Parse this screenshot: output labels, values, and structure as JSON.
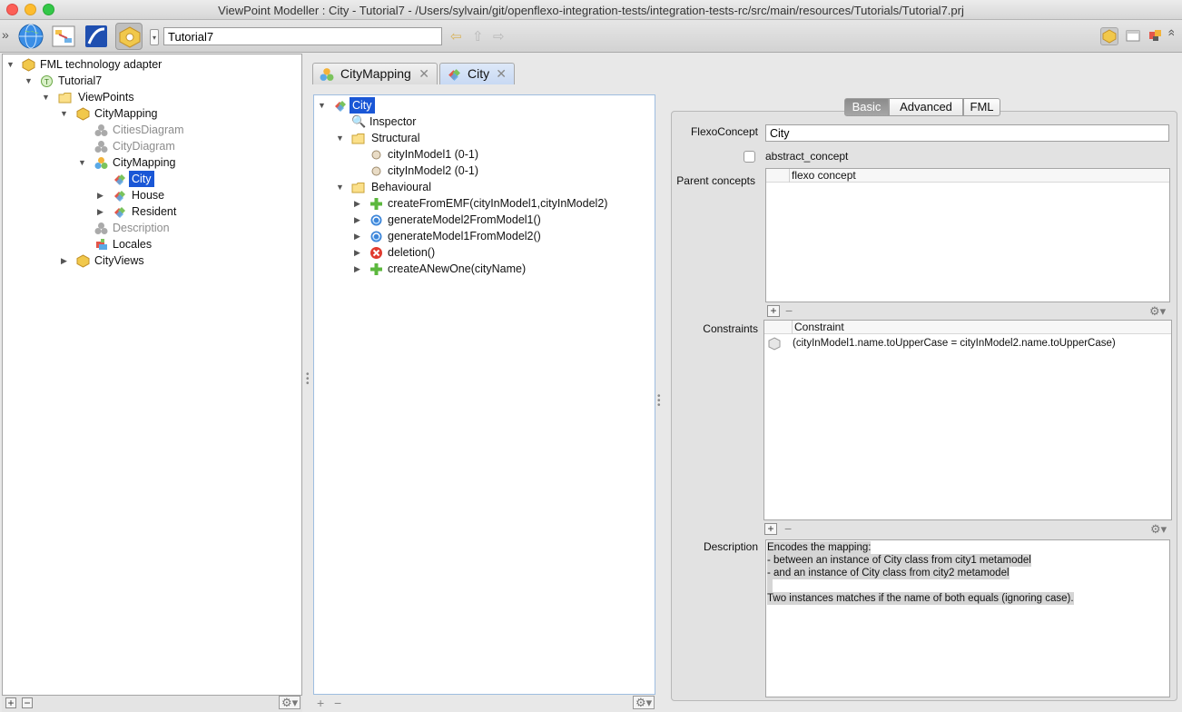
{
  "window": {
    "title": "ViewPoint Modeller : City - Tutorial7 - /Users/sylvain/git/openflexo-integration-tests/integration-tests-rc/src/main/resources/Tutorials/Tutorial7.prj"
  },
  "toolbar": {
    "module_field_value": "Tutorial7"
  },
  "left_tree": {
    "root": "FML technology adapter",
    "project": "Tutorial7",
    "viewpoints": "ViewPoints",
    "viewpoint_citymapping": "CityMapping",
    "cities_diagram": "CitiesDiagram",
    "city_diagram": "CityDiagram",
    "virtual_model_citymapping": "CityMapping",
    "concept_city": "City",
    "concept_house": "House",
    "concept_resident": "Resident",
    "description": "Description",
    "locales": "Locales",
    "cityviews": "CityViews"
  },
  "tabs": [
    {
      "label": "CityMapping"
    },
    {
      "label": "City"
    }
  ],
  "center_tree": {
    "root": "City",
    "inspector": "Inspector",
    "structural": "Structural",
    "property_1": "cityInModel1 (0-1)",
    "property_2": "cityInModel2 (0-1)",
    "behavioural": "Behavioural",
    "behaviour_1": "createFromEMF(cityInModel1,cityInModel2)",
    "behaviour_2": "generateModel2FromModel1()",
    "behaviour_3": "generateModel1FromModel2()",
    "behaviour_4": "deletion()",
    "behaviour_5": "createANewOne(cityName)"
  },
  "inspector": {
    "tabs": [
      "Basic",
      "Advanced",
      "FML"
    ],
    "flexo_concept_label": "FlexoConcept",
    "flexo_concept_value": "City",
    "abstract_label": "abstract_concept",
    "parent_concepts_label": "Parent concepts",
    "parent_concepts_header": "flexo concept",
    "constraints_label": "Constraints",
    "constraints_header": "Constraint",
    "constraint_1": "(cityInModel1.name.toUpperCase = cityInModel2.name.toUpperCase)",
    "description_label": "Description",
    "description_lines": [
      "Encodes the mapping:",
      "- between an instance of City class from city1 metamodel",
      "- and an instance of City class from city2 metamodel",
      "",
      "Two instances matches if the name of both equals (ignoring case)."
    ]
  },
  "controls": {
    "add": "+",
    "remove": "−",
    "gear": "⚙▾"
  }
}
